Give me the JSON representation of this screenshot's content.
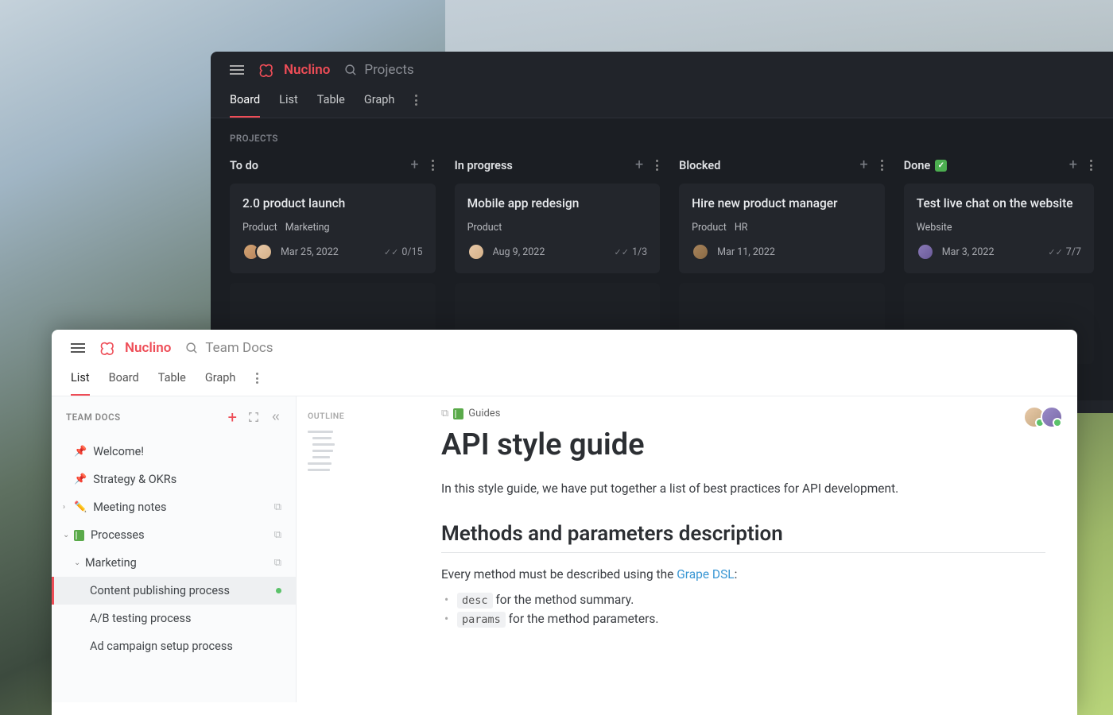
{
  "brand": "Nuclino",
  "dark": {
    "search_placeholder": "Projects",
    "tabs": [
      "Board",
      "List",
      "Table",
      "Graph"
    ],
    "active_tab": 0,
    "section_label": "PROJECTS",
    "columns": [
      {
        "title": "To do",
        "cards": [
          {
            "title": "2.0 product launch",
            "tags": [
              "Product",
              "Marketing"
            ],
            "avatars": 2,
            "date": "Mar 25, 2022",
            "check": "0/15"
          }
        ]
      },
      {
        "title": "In progress",
        "cards": [
          {
            "title": "Mobile app redesign",
            "tags": [
              "Product"
            ],
            "avatars": 1,
            "date": "Aug 9, 2022",
            "check": "1/3"
          }
        ]
      },
      {
        "title": "Blocked",
        "cards": [
          {
            "title": "Hire new product manager",
            "tags": [
              "Product",
              "HR"
            ],
            "avatars": 1,
            "date": "Mar 11, 2022",
            "check": ""
          }
        ]
      },
      {
        "title": "Done",
        "done_badge": true,
        "cards": [
          {
            "title": "Test live chat on the website",
            "tags": [
              "Website"
            ],
            "avatars": 1,
            "date": "Mar 3, 2022",
            "check": "7/7"
          }
        ]
      }
    ]
  },
  "light": {
    "search_placeholder": "Team Docs",
    "tabs": [
      "List",
      "Board",
      "Table",
      "Graph"
    ],
    "active_tab": 0,
    "sidebar_label": "TEAM DOCS",
    "tree": [
      {
        "icon": "📌",
        "label": "Welcome!",
        "indent": 0
      },
      {
        "icon": "📌",
        "label": "Strategy & OKRs",
        "indent": 0
      },
      {
        "arrow": "›",
        "icon": "✏️",
        "label": "Meeting notes",
        "indent": 0,
        "copy": true
      },
      {
        "arrow": "⌄",
        "icon": "book",
        "label": "Processes",
        "indent": 0,
        "copy": true
      },
      {
        "arrow": "⌄",
        "label": "Marketing",
        "indent": 1,
        "copy": true
      },
      {
        "label": "Content publishing process",
        "indent": 2,
        "selected": true,
        "dot": true
      },
      {
        "label": "A/B testing process",
        "indent": 2
      },
      {
        "label": "Ad campaign setup process",
        "indent": 2
      }
    ],
    "outline_label": "OUTLINE",
    "doc": {
      "breadcrumb": "Guides",
      "title": "API style guide",
      "intro": "In this style guide, we have put together a list of best practices for API development.",
      "h2": "Methods and parameters description",
      "p2_pre": "Every method must be described using the ",
      "p2_link": "Grape DSL",
      "p2_post": ":",
      "li1_code": "desc",
      "li1_text": " for the method summary.",
      "li2_code": "params",
      "li2_text": " for the method parameters."
    }
  }
}
